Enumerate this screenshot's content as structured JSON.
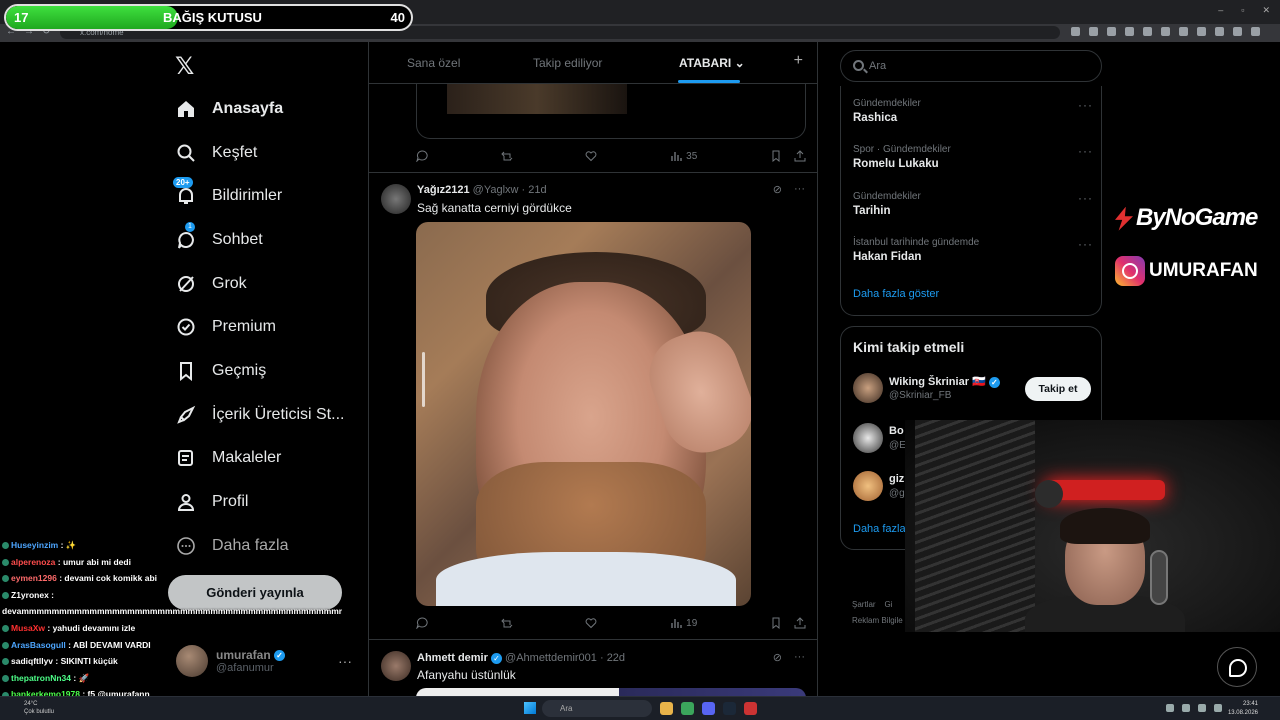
{
  "browser": {
    "url": "x.com/home",
    "window_controls": [
      "–",
      "▫",
      "✕"
    ],
    "nav_glyphs": [
      "←",
      "→",
      "↻"
    ]
  },
  "donation": {
    "left_value": "17",
    "title": "BAĞIŞ KUTUSU",
    "right_value": "40",
    "progress": 0.425,
    "fill_color": "#2ecc2e"
  },
  "sidebar": {
    "logo": "𝕏",
    "items": [
      {
        "label": "Anasayfa",
        "icon": "home-icon",
        "active": true
      },
      {
        "label": "Keşfet",
        "icon": "search-icon"
      },
      {
        "label": "Bildirimler",
        "icon": "bell-icon",
        "badge": "20+"
      },
      {
        "label": "Sohbet",
        "icon": "chat-icon",
        "badge": "1"
      },
      {
        "label": "Grok",
        "icon": "grok-icon"
      },
      {
        "label": "Premium",
        "icon": "premium-icon"
      },
      {
        "label": "Geçmiş",
        "icon": "bookmark-icon"
      },
      {
        "label": "İçerik Üreticisi St...",
        "icon": "rocket-icon"
      },
      {
        "label": "Makaleler",
        "icon": "article-icon"
      },
      {
        "label": "Profil",
        "icon": "profile-icon"
      },
      {
        "label": "Daha fazla",
        "icon": "more-icon"
      }
    ],
    "post_button": "Gönderi yayınla",
    "account": {
      "name": "umurafan",
      "handle": "@afanumur",
      "more": "···"
    }
  },
  "feed": {
    "tabs": [
      {
        "label": "Sana özel"
      },
      {
        "label": "Takip ediliyor"
      },
      {
        "label": "ATABARI",
        "active": true
      }
    ],
    "add_tab": "+",
    "chevron": "⌄",
    "prev_tweet_actions": {
      "views": "35"
    },
    "tweets": [
      {
        "name": "Yağız2121",
        "handle": "@Yaglxw",
        "time": "· 21d",
        "text": "Sağ kanatta cerniyi gördükce",
        "views": "19"
      },
      {
        "name": "Ahmett demir",
        "handle": "@Ahmettdemir001",
        "time": "· 22d",
        "text": "Afanyahu üstünlük"
      }
    ]
  },
  "right": {
    "search_placeholder": "Ara",
    "trends": [
      {
        "category": "Gündemdekiler",
        "title": "Rashica"
      },
      {
        "category": "Spor · Gündemdekiler",
        "title": "Romelu Lukaku"
      },
      {
        "category": "Gündemdekiler",
        "title": "Tarihin"
      },
      {
        "category": "İstanbul tarihinde gündemde",
        "title": "Hakan Fidan"
      }
    ],
    "trends_more": "···",
    "show_more": "Daha fazla göster",
    "who_to_follow": {
      "title": "Kimi takip etmeli",
      "users": [
        {
          "name": "Wiking Škriniar 🇸🇰",
          "handle": "@Skriniar_FB"
        },
        {
          "name": "Bo",
          "handle": "@E"
        },
        {
          "name": "giz",
          "handle": "@g"
        }
      ],
      "follow_label": "Takip et",
      "more": "Daha fazla"
    },
    "footer": [
      "Şartlar",
      "Gi",
      "Reklam Bilgile"
    ]
  },
  "overlay": {
    "brand1": "ByNoGame",
    "brand2": "UMURAFAN"
  },
  "chat": [
    {
      "user": "Huseyinzim",
      "color": "#4da6ff",
      "msg": " : ✨"
    },
    {
      "user": "alperenoza",
      "color": "#ff4d4d",
      "msg": " : umur abi mi dedi"
    },
    {
      "user": "eymen1296",
      "color": "#ff6b6b",
      "msg": " : devami cok komikk abi"
    },
    {
      "user": "Z1yronex",
      "color": "#ffffff",
      "msg": " :"
    },
    {
      "user": "",
      "color": "#ffffff",
      "msg": "devammmmmmmmmmmmmmmmmmmmmmmmmmmmmmmmmmmmmmmmmmmmm"
    },
    {
      "user": "MusaXw",
      "color": "#ff3030",
      "msg": " : yahudi devamını izle"
    },
    {
      "user": "ArasBasogull",
      "color": "#4da6ff",
      "msg": " : ABİ DEVAMI VARDI"
    },
    {
      "user": "sadiqftllyv",
      "color": "#ffffff",
      "msg": " : SIKINTI küçük"
    },
    {
      "user": "thepatronNn34",
      "color": "#4dff88",
      "msg": " : 🚀"
    },
    {
      "user": "bankerkemo1978",
      "color": "#4dff4d",
      "msg": " : f5 @umurafann"
    }
  ],
  "taskbar": {
    "weather_temp": "24°C",
    "weather_desc": "Çok bulutlu",
    "search": "Ara",
    "time": "23:41",
    "date": "13.08.2026"
  }
}
